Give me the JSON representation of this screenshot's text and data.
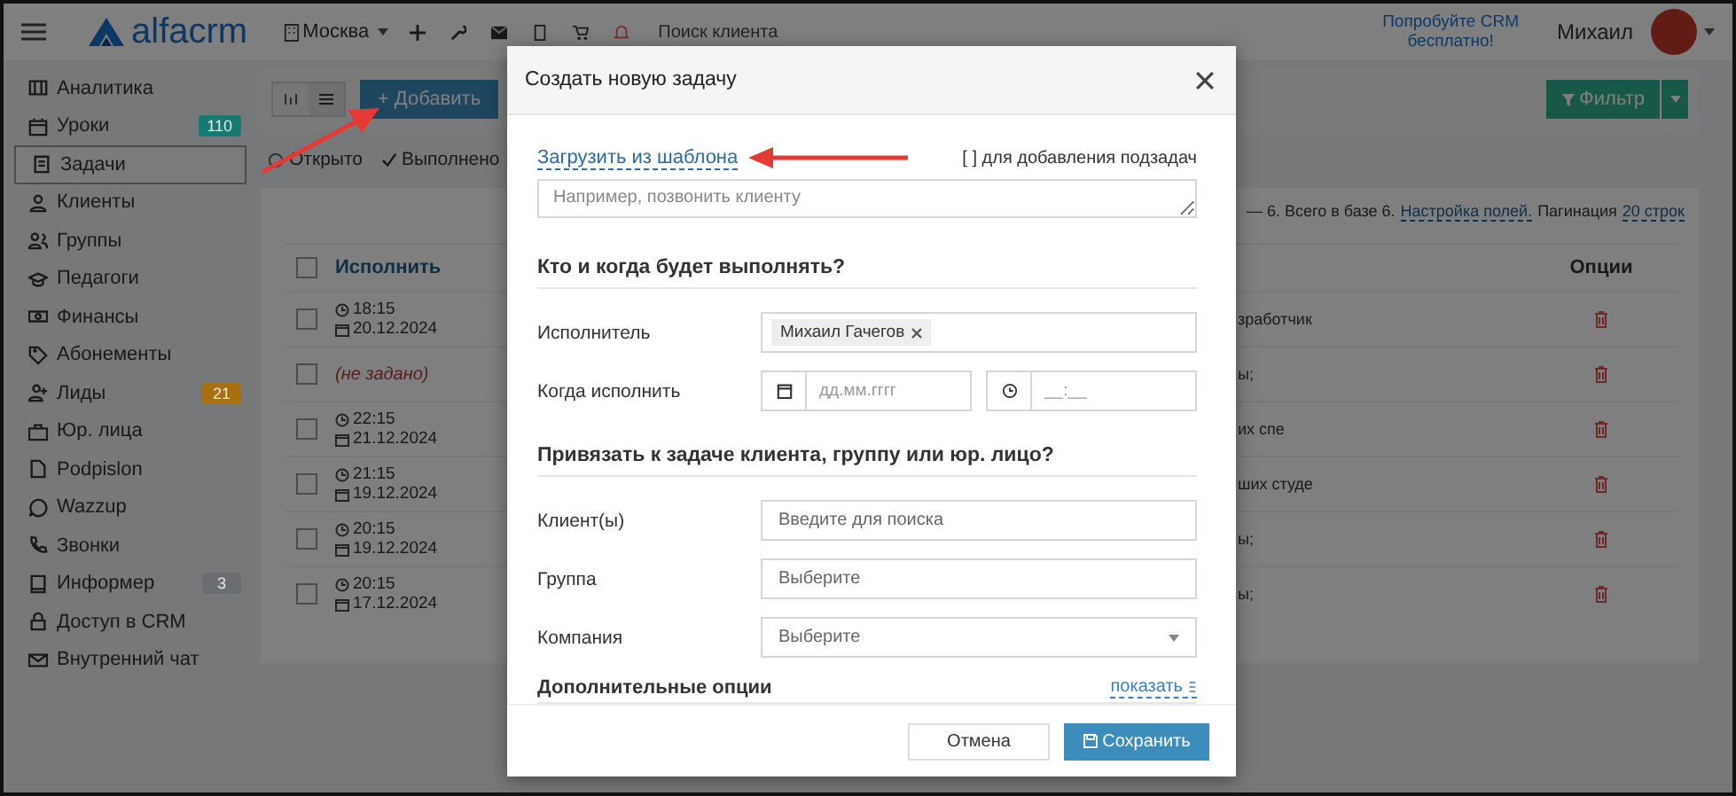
{
  "topbar": {
    "logo": "alfacrm",
    "branch": "Москва",
    "search_placeholder": "Поиск клиента",
    "promo": "Попробуйте CRM бесплатно!",
    "user": "Михаил"
  },
  "sidebar": {
    "items": [
      {
        "kind": "analytics",
        "label": "Аналитика",
        "selected": false
      },
      {
        "kind": "calendar",
        "label": "Уроки",
        "selected": false,
        "badge": "110",
        "color": "#167a72"
      },
      {
        "kind": "tasks",
        "label": "Задачи",
        "selected": true
      },
      {
        "kind": "user",
        "label": "Клиенты",
        "selected": false
      },
      {
        "kind": "users",
        "label": "Группы",
        "selected": false
      },
      {
        "kind": "cap",
        "label": "Педагоги",
        "selected": false
      },
      {
        "kind": "money",
        "label": "Финансы",
        "selected": false
      },
      {
        "kind": "tag",
        "label": "Абонементы",
        "selected": false
      },
      {
        "kind": "useradd",
        "label": "Лиды",
        "selected": false,
        "badge": "21",
        "color": "#a8700e"
      },
      {
        "kind": "case",
        "label": "Юр. лица",
        "selected": false
      },
      {
        "kind": "file",
        "label": "Podpislon",
        "selected": false
      },
      {
        "kind": "chat",
        "label": "Wazzup",
        "selected": false
      },
      {
        "kind": "phone",
        "label": "Звонки",
        "selected": false
      },
      {
        "kind": "book",
        "label": "Информер",
        "selected": false,
        "badge": "3",
        "color": "#6b6e71"
      },
      {
        "kind": "lock",
        "label": "Доступ в CRM",
        "selected": false
      },
      {
        "kind": "mail",
        "label": "Внутренний чат",
        "selected": false
      }
    ]
  },
  "toolbar": {
    "add_button": "+ Добавить",
    "filter_button": "Фильтр"
  },
  "status_tabs": [
    {
      "kind": "open",
      "label": "Открыто"
    },
    {
      "kind": "done",
      "label": "Выполнено"
    }
  ],
  "table": {
    "summary": "— 6. Всего в базе 6.",
    "settings_link": "Настройка полей.",
    "pagination_label": "Пагинация",
    "pagination_link": "20 строк",
    "columns": [
      "Исполнить",
      "Опции"
    ],
    "header_checked": false,
    "rows": [
      {
        "checked": false,
        "time": "18:15",
        "date": "20.12.2024",
        "column_3": "зработчик"
      },
      {
        "checked": false,
        "not_set": "(не задано)",
        "column_3": "ы;"
      },
      {
        "checked": false,
        "time": "22:15",
        "date": "21.12.2024",
        "column_3": "их спе"
      },
      {
        "checked": false,
        "time": "21:15",
        "date": "19.12.2024",
        "column_3": "ших студе"
      },
      {
        "checked": false,
        "time": "20:15",
        "date": "19.12.2024",
        "column_3": "ы;"
      },
      {
        "checked": false,
        "time": "20:15",
        "date": "17.12.2024",
        "column_3": "ы;"
      }
    ]
  },
  "modal": {
    "title": "Создать новую задачу",
    "template_link": "Загрузить из шаблона",
    "subtask_hint": "[ ] для добавления подзадач",
    "task_placeholder": "Например, позвонить клиенту",
    "section_1": "Кто и когда будет выполнять?",
    "assignee_label": "Исполнитель",
    "assignee_tag": "Михаил Гачегов",
    "when_label": "Когда исполнить",
    "date_placeholder": "дд.мм.гггг",
    "time_placeholder": "__:__",
    "section_2": "Привязать к задаче клиента, группу или юр. лицо?",
    "fields": [
      {
        "kind": "input",
        "label": "Клиент(ы)",
        "placeholder": "Введите для поиска"
      },
      {
        "kind": "input",
        "label": "Группа",
        "placeholder": "Выберите"
      },
      {
        "kind": "select",
        "label": "Компания",
        "placeholder": "Выберите"
      }
    ],
    "extra_title": "Дополнительные опции",
    "extra_link": "показать",
    "cancel_button": "Отмена",
    "save_button": "Сохранить"
  }
}
